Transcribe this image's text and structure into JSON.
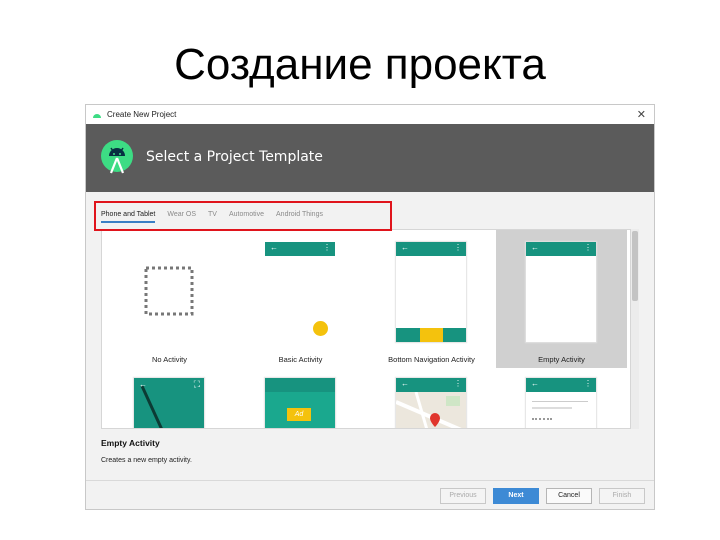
{
  "slide": {
    "title": "Создание проекта"
  },
  "window": {
    "title": "Create New Project",
    "close_glyph": "✕"
  },
  "header": {
    "title": "Select a Project Template"
  },
  "tabs": [
    {
      "label": "Phone and Tablet",
      "active": true
    },
    {
      "label": "Wear OS",
      "active": false
    },
    {
      "label": "TV",
      "active": false
    },
    {
      "label": "Automotive",
      "active": false
    },
    {
      "label": "Android Things",
      "active": false
    }
  ],
  "templates": [
    {
      "label": "No Activity",
      "selected": false
    },
    {
      "label": "Basic Activity",
      "selected": false
    },
    {
      "label": "Bottom Navigation Activity",
      "selected": false
    },
    {
      "label": "Empty Activity",
      "selected": true
    }
  ],
  "preview_glyphs": {
    "back": "←",
    "menu": "⋮",
    "fullscreen": "⛶",
    "ad_label": "Ad"
  },
  "info": {
    "title": "Empty Activity",
    "description": "Creates a new empty activity."
  },
  "buttons": {
    "previous": "Previous",
    "next": "Next",
    "cancel": "Cancel",
    "finish": "Finish"
  },
  "colors": {
    "accent": "#17937f",
    "header_bg": "#5b5b5b",
    "primary_button": "#3d8ad5",
    "highlight": "#e0141c",
    "fab": "#f4c20d"
  }
}
